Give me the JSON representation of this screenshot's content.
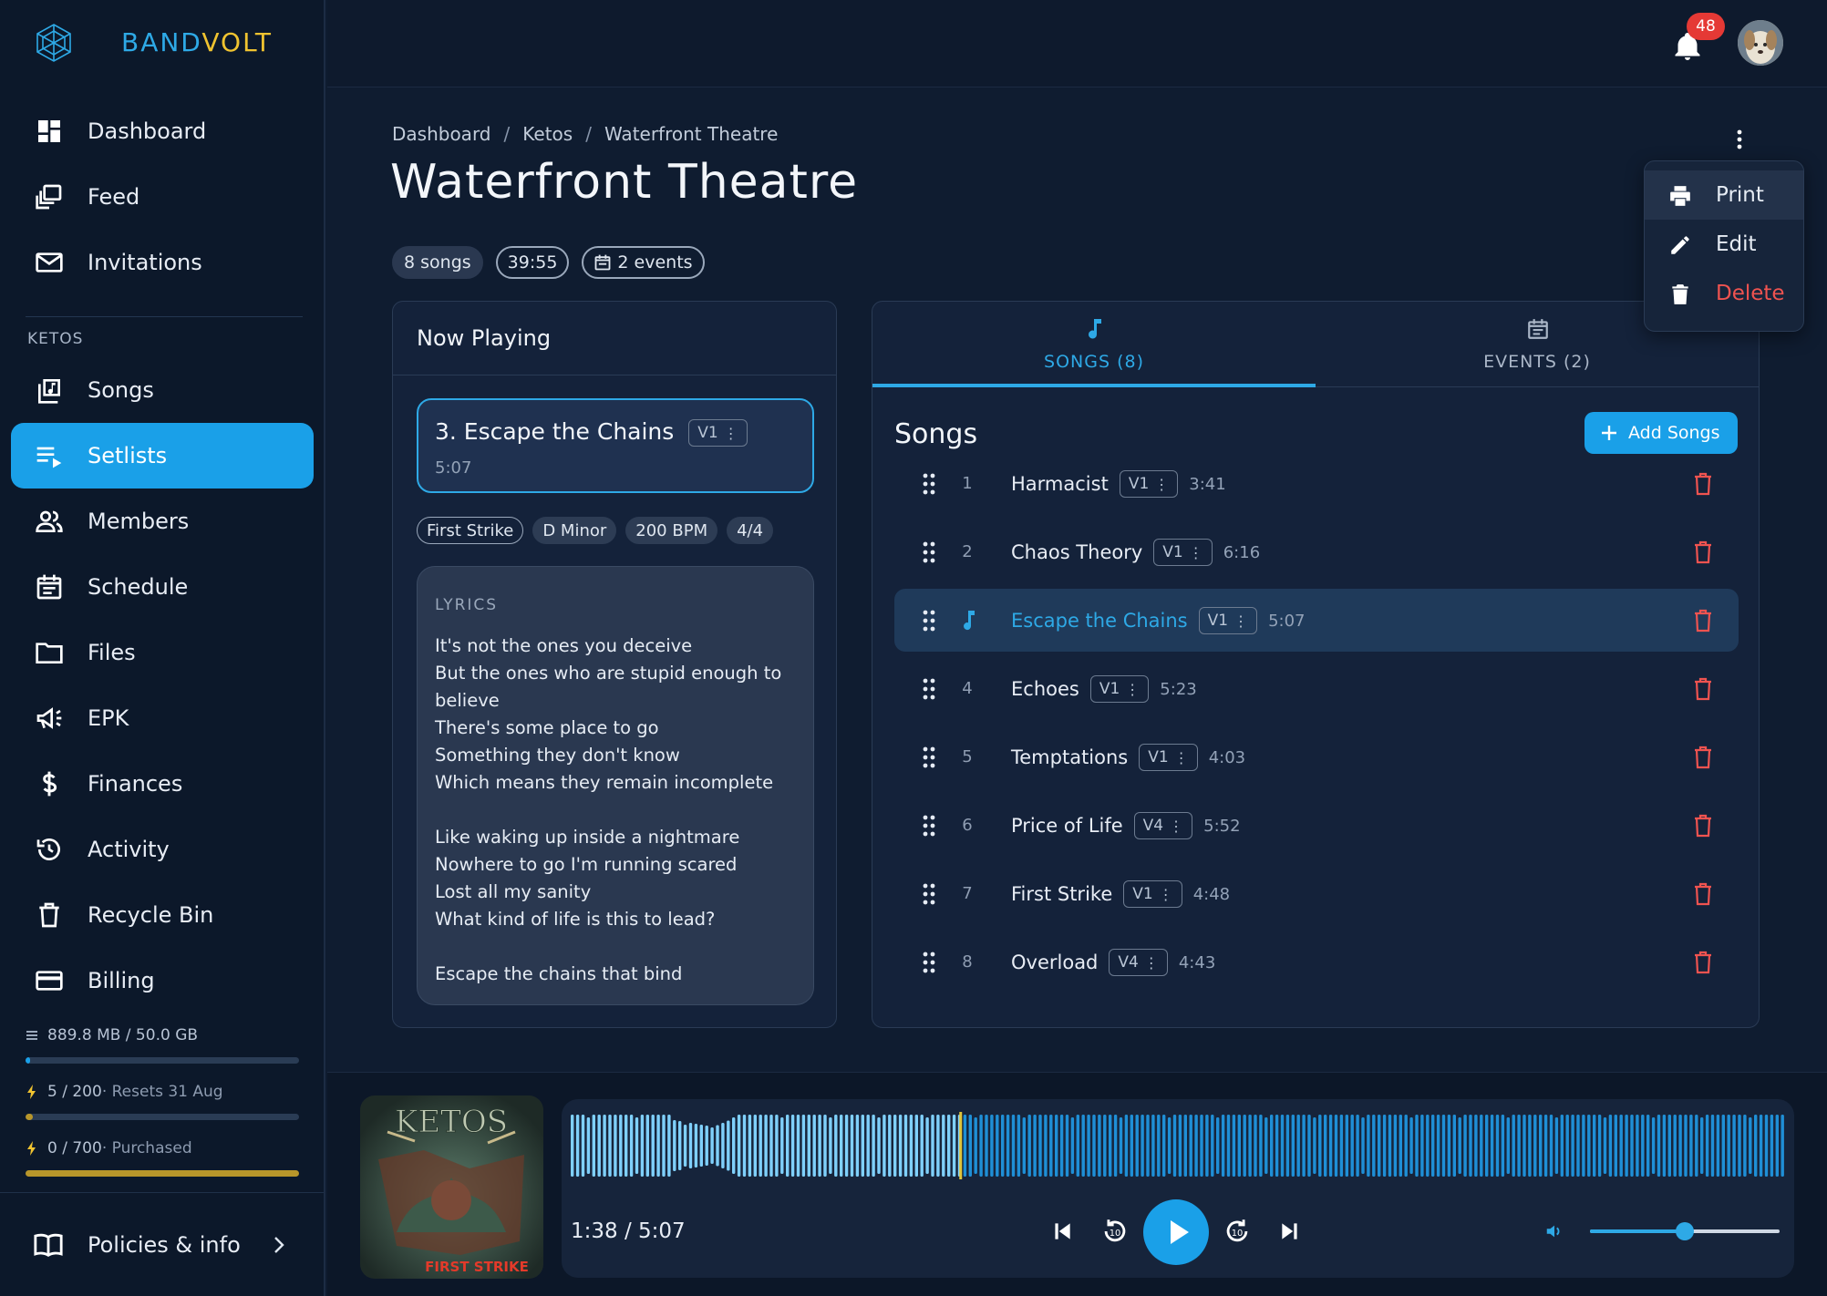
{
  "brand": {
    "part1": "BAND",
    "part2": "VOLT",
    "accent_blue": "#2ea9e6",
    "accent_yellow": "#f0c330"
  },
  "sidebar": {
    "main_items": [
      {
        "label": "Dashboard",
        "icon": "dashboard-icon"
      },
      {
        "label": "Feed",
        "icon": "feed-icon"
      },
      {
        "label": "Invitations",
        "icon": "mail-icon"
      }
    ],
    "section_label": "KETOS",
    "band_items": [
      {
        "label": "Songs",
        "icon": "music-library-icon"
      },
      {
        "label": "Setlists",
        "icon": "playlist-icon",
        "active": true
      },
      {
        "label": "Members",
        "icon": "people-icon"
      },
      {
        "label": "Schedule",
        "icon": "calendar-icon"
      },
      {
        "label": "Files",
        "icon": "folder-icon"
      },
      {
        "label": "EPK",
        "icon": "megaphone-icon"
      },
      {
        "label": "Finances",
        "icon": "dollar-icon"
      },
      {
        "label": "Activity",
        "icon": "history-icon"
      },
      {
        "label": "Recycle Bin",
        "icon": "trash-icon"
      },
      {
        "label": "Billing",
        "icon": "credit-card-icon"
      }
    ],
    "usage": [
      {
        "text": "889.8 MB / 50.0 GB",
        "sub": "",
        "fraction": 0.018,
        "color": "#1aa0e8",
        "icon": "storage-icon"
      },
      {
        "text": "5 / 200",
        "sub": " · Resets 31 Aug",
        "fraction": 0.025,
        "color": "#b8962a",
        "icon": "bolt-icon"
      },
      {
        "text": "0 / 700",
        "sub": " · Purchased",
        "fraction": 0.0,
        "color": "#b8962a",
        "icon": "bolt-icon"
      }
    ],
    "policies_label": "Policies & info"
  },
  "topbar": {
    "notification_count": "48"
  },
  "breadcrumb": [
    "Dashboard",
    "Ketos",
    "Waterfront Theatre"
  ],
  "page_title": "Waterfront Theatre",
  "chips": {
    "songs": "8 songs",
    "duration": "39:55",
    "events": "2 events"
  },
  "menu": {
    "print": "Print",
    "edit": "Edit",
    "delete": "Delete"
  },
  "now_playing": {
    "title": "Now Playing",
    "song_title": "3. Escape the Chains",
    "version": "V1",
    "duration": "5:07",
    "tags": [
      "First Strike",
      "D Minor",
      "200 BPM",
      "4/4"
    ],
    "lyrics_label": "LYRICS",
    "lyrics": "It's not the ones you deceive\nBut the ones who are stupid enough to believe\nThere's some place to go\nSomething they don't know\nWhich means they remain incomplete\n\nLike waking up inside a nightmare\nNowhere to go I'm running scared\nLost all my sanity\nWhat kind of life is this to lead?\n\nEscape the chains that bind"
  },
  "tabs": {
    "songs": "SONGS (8)",
    "events": "EVENTS (2)"
  },
  "songs_heading": "Songs",
  "add_songs_label": "Add Songs",
  "songs": [
    {
      "num": "1",
      "name": "Harmacist",
      "version": "V1",
      "duration": "3:41"
    },
    {
      "num": "2",
      "name": "Chaos Theory",
      "version": "V1",
      "duration": "6:16"
    },
    {
      "num": "3",
      "name": "Escape the Chains",
      "version": "V1",
      "duration": "5:07",
      "playing": true
    },
    {
      "num": "4",
      "name": "Echoes",
      "version": "V1",
      "duration": "5:23"
    },
    {
      "num": "5",
      "name": "Temptations",
      "version": "V1",
      "duration": "4:03"
    },
    {
      "num": "6",
      "name": "Price of Life",
      "version": "V4",
      "duration": "5:52"
    },
    {
      "num": "7",
      "name": "First Strike",
      "version": "V1",
      "duration": "4:48"
    },
    {
      "num": "8",
      "name": "Overload",
      "version": "V4",
      "duration": "4:43"
    }
  ],
  "player": {
    "time_readout": "1:38 / 5:07",
    "progress": 0.32,
    "volume": 0.5,
    "album_text_top": "KETOS",
    "album_text_bottom": "FIRST STRIKE"
  }
}
